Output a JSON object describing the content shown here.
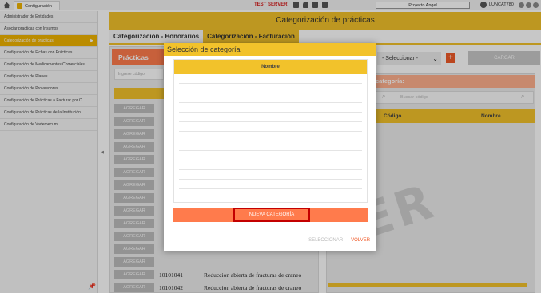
{
  "topbar": {
    "tab_label": "Configuración",
    "server_label": "TEST SERVER",
    "project": "Projecto Angel",
    "user": "LUNCAT780"
  },
  "sidebar": {
    "items": [
      {
        "label": "Administrador de Entidades",
        "active": false
      },
      {
        "label": "Asociar practicas con Insumos",
        "active": false
      },
      {
        "label": "Categorización de prácticas",
        "active": true
      },
      {
        "label": "Configuración de Fichas con Prácticas",
        "active": false
      },
      {
        "label": "Configuración de Medicamentos Comerciales",
        "active": false
      },
      {
        "label": "Configuración de Planes",
        "active": false
      },
      {
        "label": "Configuración de Proveedores",
        "active": false
      },
      {
        "label": "Configuración de Prácticas a Facturar por C...",
        "active": false
      },
      {
        "label": "Configuración de Prácticas de la Institución",
        "active": false
      },
      {
        "label": "Configuración de Vademecum",
        "active": false
      }
    ],
    "active_arrow": "▶"
  },
  "main": {
    "title": "Categorización de prácticas",
    "tabs": [
      {
        "label": "Categorización - Honorarios"
      },
      {
        "label": "Categorización - Facturación"
      }
    ]
  },
  "left_panel": {
    "header": "Prácticas",
    "search_placeholder": "Ingrese código",
    "add_label": "AGREGAR",
    "rows": [
      {
        "code": "",
        "name": ""
      },
      {
        "code": "",
        "name": ""
      },
      {
        "code": "",
        "name": ""
      },
      {
        "code": "",
        "name": ""
      },
      {
        "code": "",
        "name": ""
      },
      {
        "code": "",
        "name": ""
      },
      {
        "code": "",
        "name": ""
      },
      {
        "code": "",
        "name": ""
      },
      {
        "code": "",
        "name": ""
      },
      {
        "code": "",
        "name": ""
      },
      {
        "code": "",
        "name": ""
      },
      {
        "code": "",
        "name": ""
      },
      {
        "code": "",
        "name": ""
      },
      {
        "code": "10101041",
        "name": "Reduccion abierta de fracturas de craneo"
      },
      {
        "code": "10101042",
        "name": "Reduccion abierta de fracturas de craneo"
      }
    ]
  },
  "right_panel": {
    "select_placeholder": "- Seleccionar -",
    "add_btn": "+",
    "load_btn": "CARGAR",
    "header": "categoría:",
    "search_placeholder": "Buscar código",
    "col_code": "Código",
    "col_name": "Nombre",
    "watermark": "ER"
  },
  "modal": {
    "title": "Selección de categoría",
    "col_name": "Nombre",
    "new_category": "NUEVA CATEGORÍA",
    "select_btn": "SELECCIONAR",
    "back_btn": "VOLVER"
  }
}
